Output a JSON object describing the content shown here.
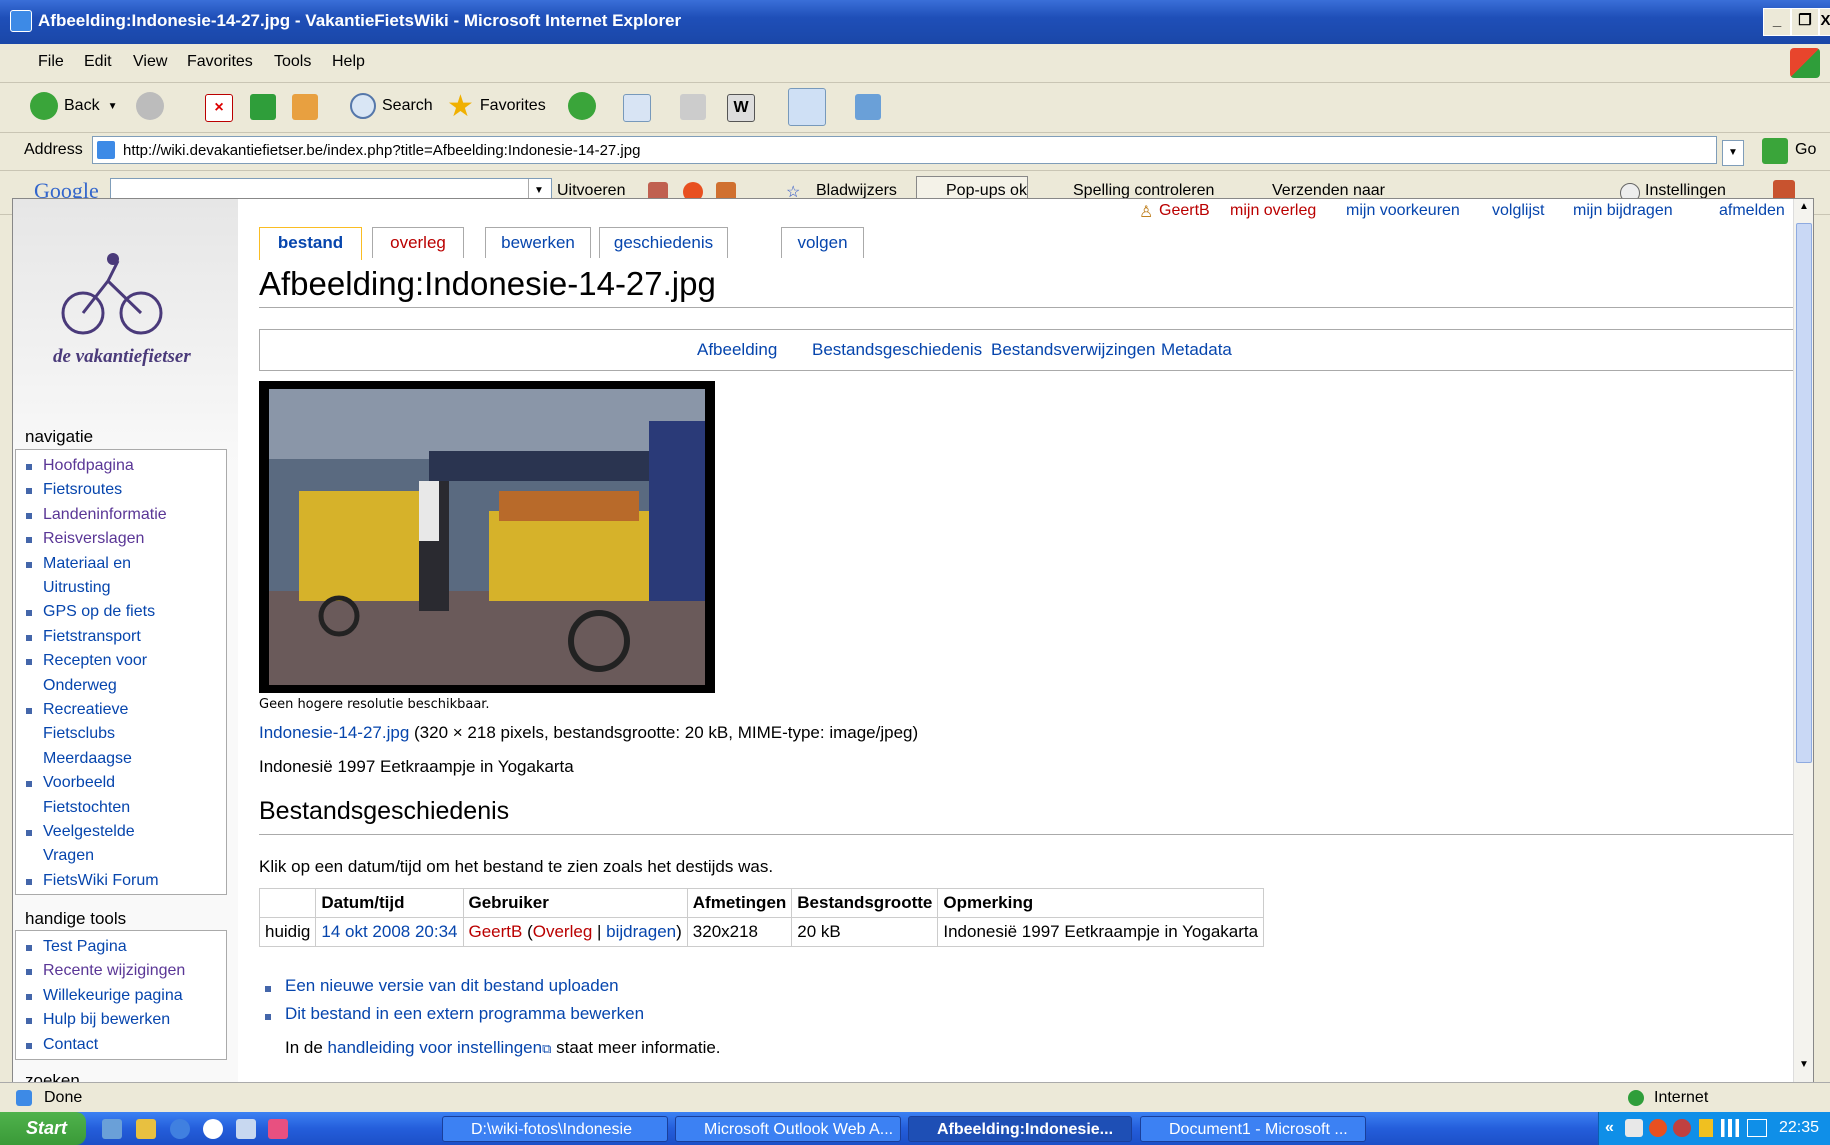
{
  "window": {
    "title": "Afbeelding:Indonesie-14-27.jpg - VakantieFietsWiki - Microsoft Internet Explorer",
    "controls": [
      "_",
      "❐",
      "X"
    ]
  },
  "menu": [
    "File",
    "Edit",
    "View",
    "Favorites",
    "Tools",
    "Help"
  ],
  "toolbar": {
    "back": "Back",
    "search": "Search",
    "favorites": "Favorites"
  },
  "address": {
    "label": "Address",
    "url": "http://wiki.devakantiefietser.be/index.php?title=Afbeelding:Indonesie-14-27.jpg",
    "go": "Go"
  },
  "googlebar": {
    "brand": "Google",
    "uitvoeren": "Uitvoeren",
    "bladwijzers": "Bladwijzers",
    "popups": "Pop-ups ok",
    "spelling": "Spelling controleren",
    "verzenden": "Verzenden naar",
    "instellingen": "Instellingen"
  },
  "personal": {
    "user": "GeertB",
    "talk": "mijn overleg",
    "prefs": "mijn voorkeuren",
    "watchlist": "volglijst",
    "contribs": "mijn bijdragen",
    "logout": "afmelden"
  },
  "tabs": [
    "bestand",
    "overleg",
    "bewerken",
    "geschiedenis",
    "volgen"
  ],
  "page": {
    "title": "Afbeelding:Indonesie-14-27.jpg",
    "toc": [
      "Afbeelding",
      "Bestandsgeschiedenis",
      "Bestandsverwijzingen",
      "Metadata"
    ],
    "no_higher_res": "Geen hogere resolutie beschikbaar.",
    "file_link": "Indonesie-14-27.jpg",
    "file_info": "(320 × 218 pixels, bestandsgrootte: 20 kB, MIME-type: image/jpeg)",
    "description": "Indonesië 1997 Eetkraampje in Yogakarta",
    "history_heading": "Bestandsgeschiedenis",
    "history_intro": "Klik op een datum/tijd om het bestand te zien zoals het destijds was.",
    "history_headers": [
      "",
      "Datum/tijd",
      "Gebruiker",
      "Afmetingen",
      "Bestandsgrootte",
      "Opmerking"
    ],
    "history_row": {
      "status": "huidig",
      "date": "14 okt 2008 20:34",
      "user": "GeertB",
      "talk": "Overleg",
      "contribs": "bijdragen",
      "dims": "320x218",
      "size": "20 kB",
      "comment": "Indonesië 1997 Eetkraampje in Yogakarta"
    },
    "upload_link": "Een nieuwe versie van dit bestand uploaden",
    "edit_external": "Dit bestand in een extern programma bewerken",
    "manual_prefix": "In de",
    "manual_link": "handleiding voor instellingen",
    "manual_suffix": "staat meer informatie."
  },
  "sidebar": {
    "logo_text": "de vakantiefietser",
    "nav_title": "navigatie",
    "nav": [
      {
        "label": "Hoofdpagina",
        "visited": true
      },
      {
        "label": "Fietsroutes",
        "visited": false
      },
      {
        "label": "Landeninformatie",
        "visited": true
      },
      {
        "label": "Reisverslagen",
        "visited": true
      },
      {
        "label": "Materiaal en",
        "visited": false
      },
      {
        "label": "Uitrusting",
        "visited": false
      },
      {
        "label": "GPS op de fiets",
        "visited": false
      },
      {
        "label": "Fietstransport",
        "visited": false
      },
      {
        "label": "Recepten voor",
        "visited": false
      },
      {
        "label": "Onderweg",
        "visited": false
      },
      {
        "label": "Recreatieve",
        "visited": false
      },
      {
        "label": "Fietsclubs",
        "visited": false
      },
      {
        "label": "Meerdaagse",
        "visited": false
      },
      {
        "label": "Voorbeeld",
        "visited": false
      },
      {
        "label": "Fietstochten",
        "visited": false
      },
      {
        "label": "Veelgestelde",
        "visited": false
      },
      {
        "label": "Vragen",
        "visited": false
      },
      {
        "label": "FietsWiki Forum",
        "visited": false
      }
    ],
    "tools_title": "handige tools",
    "tools": [
      "Test Pagina",
      "Recente wijzigingen",
      "Willekeurige pagina",
      "Hulp bij bewerken",
      "Contact"
    ],
    "search_title": "zoeken"
  },
  "status": {
    "text": "Done",
    "zone": "Internet"
  },
  "taskbar": {
    "start": "Start",
    "tasks": [
      "D:\\wiki-fotos\\Indonesie",
      "Microsoft Outlook Web A...",
      "Afbeelding:Indonesie...",
      "Document1 - Microsoft ..."
    ],
    "clock": "22:35"
  },
  "colors": {
    "link": "#0645ad",
    "new_link": "#ba0000",
    "visited": "#5a3696",
    "xp_blue": "#245edb"
  }
}
